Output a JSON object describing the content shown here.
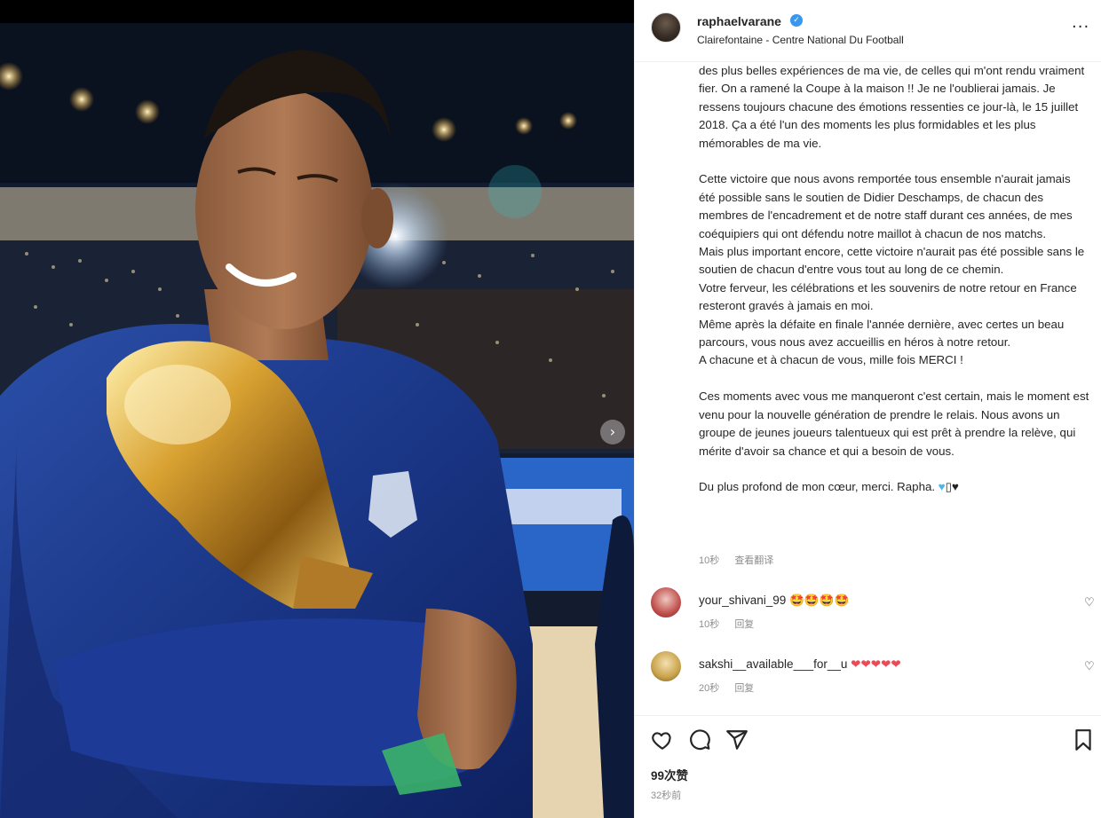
{
  "post": {
    "username": "raphaelvarane",
    "verified": true,
    "location": "Clairefontaine - Centre National Du Football"
  },
  "caption": {
    "paragraph1": "des plus belles expériences de ma vie, de celles qui m'ont rendu vraiment fier. On a ramené la Coupe à la maison !! Je ne l'oublierai jamais. Je ressens toujours chacune des émotions ressenties ce jour-là, le 15 juillet 2018. Ça a été l'un des moments les plus formidables et les plus mémorables de ma vie.",
    "paragraph2": "Cette victoire que nous avons remportée tous ensemble n'aurait jamais été possible sans le soutien de Didier Deschamps, de chacun des membres de l'encadrement et de notre staff durant ces années, de mes coéquipiers qui ont défendu notre maillot à chacun de nos matchs.",
    "paragraph3": "Mais plus important encore, cette victoire n'aurait pas été possible sans le soutien de chacun d'entre vous tout au long de ce chemin.",
    "paragraph4": "Votre ferveur, les célébrations et les souvenirs de notre retour en France resteront gravés à jamais en moi.",
    "paragraph5": "Même après la défaite en finale l'année dernière, avec certes un beau parcours, vous nous avez accueillis en héros à notre retour.",
    "paragraph6": "A chacune et à chacun de vous, mille fois MERCI !",
    "paragraph7": "Ces moments avec vous me manqueront c'est certain, mais le moment est venu pour la nouvelle génération de prendre le relais. Nous avons un groupe de jeunes joueurs talentueux qui est prêt à prendre la relève, qui mérite d'avoir sa chance et qui a besoin de vous.",
    "signoff": "Du plus profond de mon cœur, merci. Rapha.",
    "signoff_emoji_blue": "♥",
    "signoff_emoji_box": "▯",
    "signoff_emoji_black": "♥",
    "time": "10秒",
    "translate_label": "查看翻译"
  },
  "comments": [
    {
      "username": "your_shivani_99",
      "emojis": "🤩🤩🤩🤩",
      "time": "10秒",
      "reply_label": "回复",
      "avatar_color": "#c0504d"
    },
    {
      "username": "sakshi__available___for__u",
      "emojis": "❤❤❤❤❤",
      "time": "20秒",
      "reply_label": "回复",
      "avatar_color": "#c8a24a"
    }
  ],
  "footer": {
    "likes": "99次赞",
    "time": "32秒前"
  },
  "icons": {
    "heart": "heart-icon",
    "comment": "comment-icon",
    "share": "share-icon",
    "save": "bookmark-icon",
    "more": "more-icon",
    "next": "chevron-right-icon",
    "verified": "verified-badge-icon"
  },
  "media": {
    "next_glyph": "›",
    "more_glyph": "···",
    "verified_glyph": "✓",
    "like_glyph": "♡"
  },
  "colors": {
    "accent": "#3897f0",
    "heart_red": "#ed4956",
    "meta_gray": "#8e8e8e"
  }
}
